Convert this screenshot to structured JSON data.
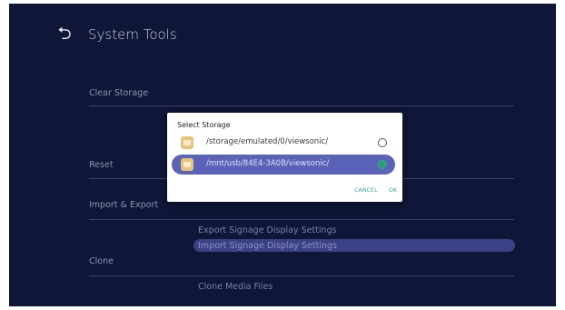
{
  "header": {
    "title": "System Tools"
  },
  "items": {
    "clear_storage": "Clear Storage",
    "reset": "Reset",
    "import_export": "Import & Export",
    "clone": "Clone"
  },
  "subitems": {
    "export_signage": "Export Signage Display Settings",
    "import_signage": "Import Signage Display Settings",
    "clone_media": "Clone Media Files"
  },
  "dialog": {
    "title": "Select Storage",
    "options": [
      {
        "path": "/storage/emulated/0/viewsonic/",
        "selected": false
      },
      {
        "path": "/mnt/usb/84E4-3A0B/viewsonic/",
        "selected": true
      }
    ],
    "cancel_label": "CANCEL",
    "ok_label": "OK"
  },
  "colors": {
    "screen_bg": "#0f1637",
    "accent": "#5b63b8",
    "button_text": "#2aa59a"
  },
  "icons": [
    "back-arrow-icon",
    "folder-icon",
    "radio-icon"
  ]
}
